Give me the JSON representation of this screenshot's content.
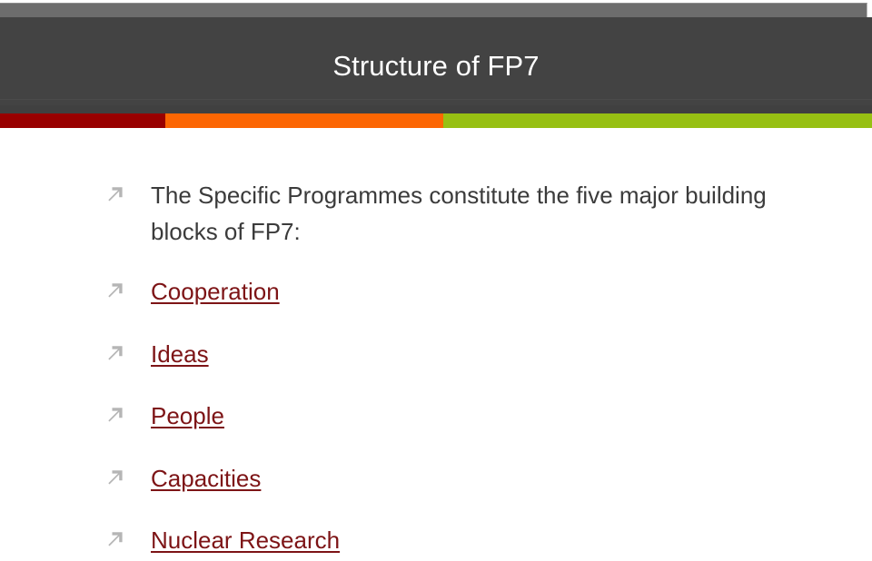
{
  "slide": {
    "title": "Structure of FP7",
    "accent_colors": {
      "red": "#990000",
      "orange": "#fc6603",
      "green": "#97c013",
      "header_bg": "#434343",
      "top_bar": "#6d6d6d",
      "link": "#7d1416",
      "body_text": "#3b3b3b",
      "bullet_icon": "#b5b5b5"
    },
    "intro": {
      "bullet_icon": "arrow-up-right-icon",
      "text": "The Specific Programmes constitute the five major building blocks of FP7:"
    },
    "items": [
      {
        "label": "Cooperation",
        "bullet_icon": "arrow-up-right-icon"
      },
      {
        "label": "Ideas",
        "bullet_icon": "arrow-up-right-icon"
      },
      {
        "label": "People",
        "bullet_icon": "arrow-up-right-icon"
      },
      {
        "label": "Capacities",
        "bullet_icon": "arrow-up-right-icon"
      },
      {
        "label": "Nuclear Research",
        "bullet_icon": "arrow-up-right-icon"
      }
    ]
  }
}
